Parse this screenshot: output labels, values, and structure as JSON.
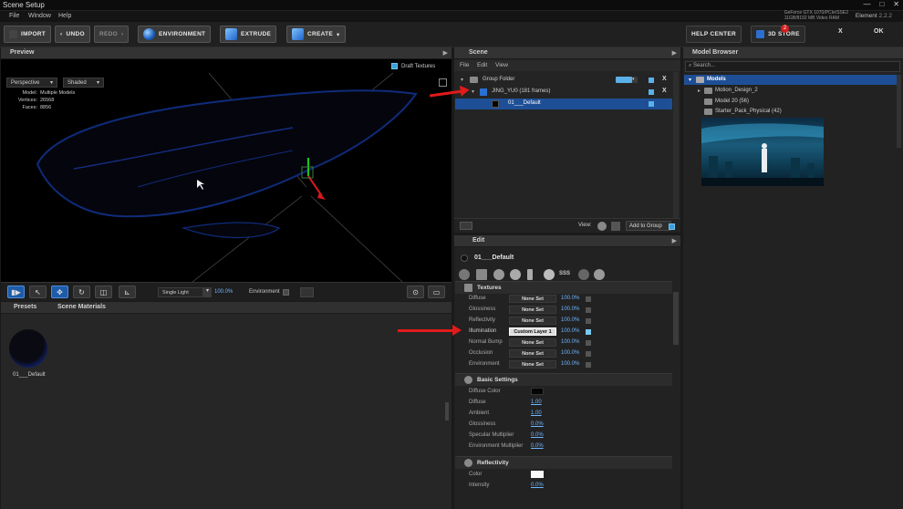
{
  "window": {
    "title": "Scene Setup",
    "menu": [
      "File",
      "Window",
      "Help"
    ],
    "gpu_info": "GeForce GTX 1070/PCIe/SSE2",
    "gpu_info2": "11GB/8192 MB Video RAM",
    "version_label": "Element",
    "version_number": "2.2.2"
  },
  "toolbar": {
    "import": "IMPORT",
    "undo": "UNDO",
    "redo": "REDO",
    "environment": "ENVIRONMENT",
    "extrude": "EXTRUDE",
    "create": "CREATE",
    "help_center": "HELP CENTER",
    "store": "3D STORE",
    "store_badge": "2",
    "close_x": "X",
    "ok": "OK"
  },
  "preview": {
    "title": "Preview",
    "draft_textures": "Draft Textures",
    "camera": "Perspective",
    "shading": "Shaded",
    "stats": [
      {
        "k": "Model:",
        "v": "Multiple Models"
      },
      {
        "k": "Vertices:",
        "v": "26568"
      },
      {
        "k": "Faces:",
        "v": "8856"
      }
    ],
    "light": "Single Light",
    "light_pct": "100.0%",
    "environment": "Environment"
  },
  "presets": {
    "tab_presets": "Presets",
    "tab_scene_materials": "Scene Materials",
    "material_name": "01___Default"
  },
  "scene": {
    "title": "Scene",
    "menu": [
      "File",
      "Edit",
      "View"
    ],
    "rows": [
      {
        "name": "Group Folder"
      },
      {
        "name": "JING_YU0 (181 frames)"
      },
      {
        "name": "01___Default"
      }
    ],
    "view_label": "View:",
    "add_to_group": "Add to Group"
  },
  "edit": {
    "title": "Edit",
    "material": "01___Default",
    "textures_title": "Textures",
    "textures": [
      {
        "label": "Diffuse",
        "set": "None Set",
        "pct": "100.0%"
      },
      {
        "label": "Glossiness",
        "set": "None Set",
        "pct": "100.0%"
      },
      {
        "label": "Reflectivity",
        "set": "None Set",
        "pct": "100.0%"
      },
      {
        "label": "Illumination",
        "set": "Custom Layer 1",
        "pct": "100.0%"
      },
      {
        "label": "Normal Bump",
        "set": "None Set",
        "pct": "100.0%"
      },
      {
        "label": "Occlusion",
        "set": "None Set",
        "pct": "100.0%"
      },
      {
        "label": "Environment",
        "set": "None Set",
        "pct": "100.0%"
      }
    ],
    "basic_title": "Basic Settings",
    "basic": [
      {
        "label": "Diffuse Color",
        "val": ""
      },
      {
        "label": "Diffuse",
        "val": "1.00"
      },
      {
        "label": "Ambient",
        "val": "1.00"
      },
      {
        "label": "Glossiness",
        "val": "0.0%"
      },
      {
        "label": "Specular Multiplier",
        "val": "0.0%"
      },
      {
        "label": "Environment Multiplier",
        "val": "0.0%"
      }
    ],
    "refl_title": "Reflectivity",
    "refl": [
      {
        "label": "Color",
        "val": ""
      },
      {
        "label": "Intensity",
        "val": "0.0%"
      }
    ]
  },
  "model_browser": {
    "title": "Model Browser",
    "search_placeholder": "Search...",
    "rows": [
      {
        "name": "Models"
      },
      {
        "name": "Motion_Design_2"
      },
      {
        "name": "Model 20 (56)"
      },
      {
        "name": "Starter_Pack_Physical (42)"
      }
    ]
  },
  "colors": {
    "accent": "#1e5ba8",
    "selection": "#1e4f96",
    "link": "#6fb6ff",
    "arrow": "#e21a1a"
  }
}
